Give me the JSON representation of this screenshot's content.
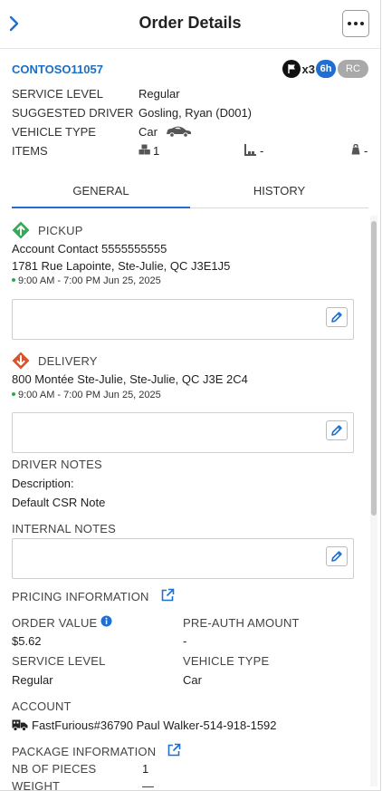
{
  "header": {
    "title": "Order Details"
  },
  "order": {
    "id": "CONTOSO11057",
    "flag_count": "x3",
    "time_badge": "6h",
    "rc_badge": "RC"
  },
  "summary": [
    {
      "label": "SERVICE LEVEL",
      "value": "Regular"
    },
    {
      "label": "SUGGESTED DRIVER",
      "value": "Gosling, Ryan (D001)"
    },
    {
      "label": "VEHICLE TYPE",
      "value": "Car"
    },
    {
      "label": "ITEMS",
      "value": "1",
      "weight": "-",
      "volume": "-"
    }
  ],
  "tabs": [
    {
      "label": "GENERAL",
      "active": true
    },
    {
      "label": "HISTORY",
      "active": false
    }
  ],
  "pickup": {
    "title": "PICKUP",
    "contact": "Account Contact 5555555555",
    "address": "1781 Rue Lapointe, Ste-Julie, QC J3E1J5",
    "window": "9:00 AM - 7:00 PM Jun 25, 2025"
  },
  "delivery": {
    "title": "DELIVERY",
    "address": "800 Montée Ste-Julie, Ste-Julie, QC J3E 2C4",
    "window": "9:00 AM - 7:00 PM Jun 25, 2025"
  },
  "driver_notes": {
    "title": "DRIVER NOTES",
    "description_label": "Description:",
    "description": "Default CSR Note"
  },
  "internal_notes": {
    "title": "INTERNAL NOTES"
  },
  "pricing": {
    "title": "PRICING INFORMATION",
    "order_value_label": "ORDER VALUE",
    "order_value": "$5.62",
    "preauth_label": "PRE-AUTH AMOUNT",
    "preauth_value": "-",
    "service_level_label": "SERVICE LEVEL",
    "service_level": "Regular",
    "vehicle_type_label": "VEHICLE TYPE",
    "vehicle_type": "Car"
  },
  "account": {
    "title": "ACCOUNT",
    "value": "FastFurious#36790 Paul Walker-514-918-1592"
  },
  "package": {
    "title": "PACKAGE INFORMATION",
    "pieces_label": "NB OF PIECES",
    "pieces": "1",
    "weight_label": "WEIGHT",
    "weight": "—"
  },
  "colors": {
    "accent": "#1e6fd0",
    "link": "#1a6fc4",
    "driver": "#e07a28",
    "pickup": "#3aa657",
    "delivery": "#d9532c"
  }
}
